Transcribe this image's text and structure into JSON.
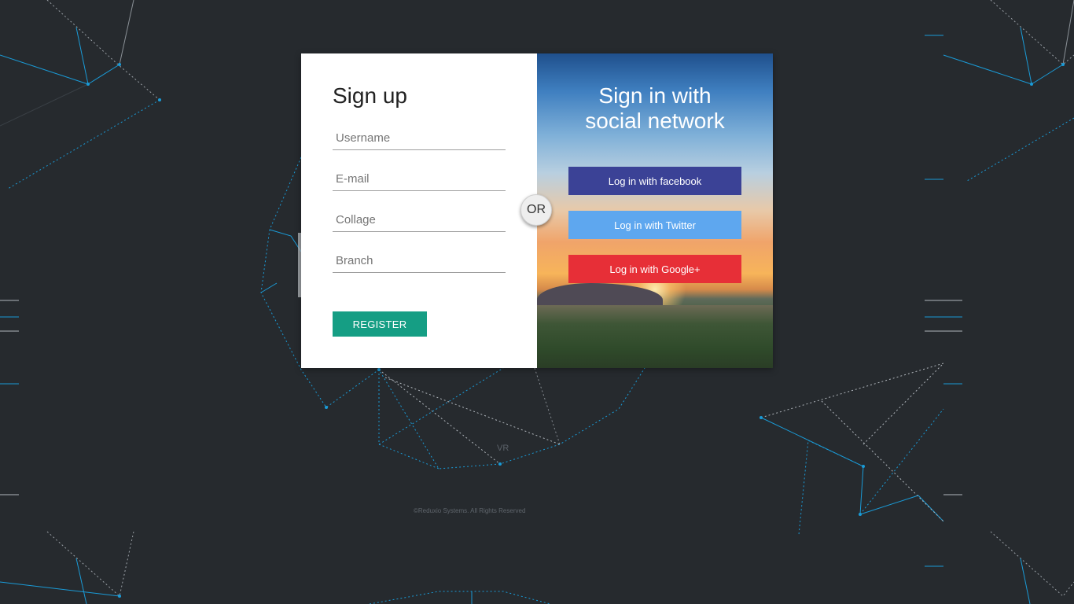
{
  "background": {
    "watermark": "VR",
    "footer": "©Reduxio Systems. All Rights Reserved"
  },
  "signup": {
    "title": "Sign up",
    "fields": [
      {
        "placeholder": "Username",
        "value": ""
      },
      {
        "placeholder": "E-mail",
        "value": ""
      },
      {
        "placeholder": "Collage",
        "value": ""
      },
      {
        "placeholder": "Branch",
        "value": ""
      }
    ],
    "register_label": "REGISTER"
  },
  "divider": {
    "label": "OR"
  },
  "social": {
    "title_line1": "Sign in with",
    "title_line2": "social network",
    "buttons": [
      {
        "label": "Log in with facebook",
        "color": "#3b4296"
      },
      {
        "label": "Log in with Twitter",
        "color": "#5ea7ef"
      },
      {
        "label": "Log in with Google+",
        "color": "#e72f37"
      }
    ]
  },
  "colors": {
    "background": "#262a2e",
    "accent": "#159e84",
    "network_line": "#1a9bd7"
  }
}
